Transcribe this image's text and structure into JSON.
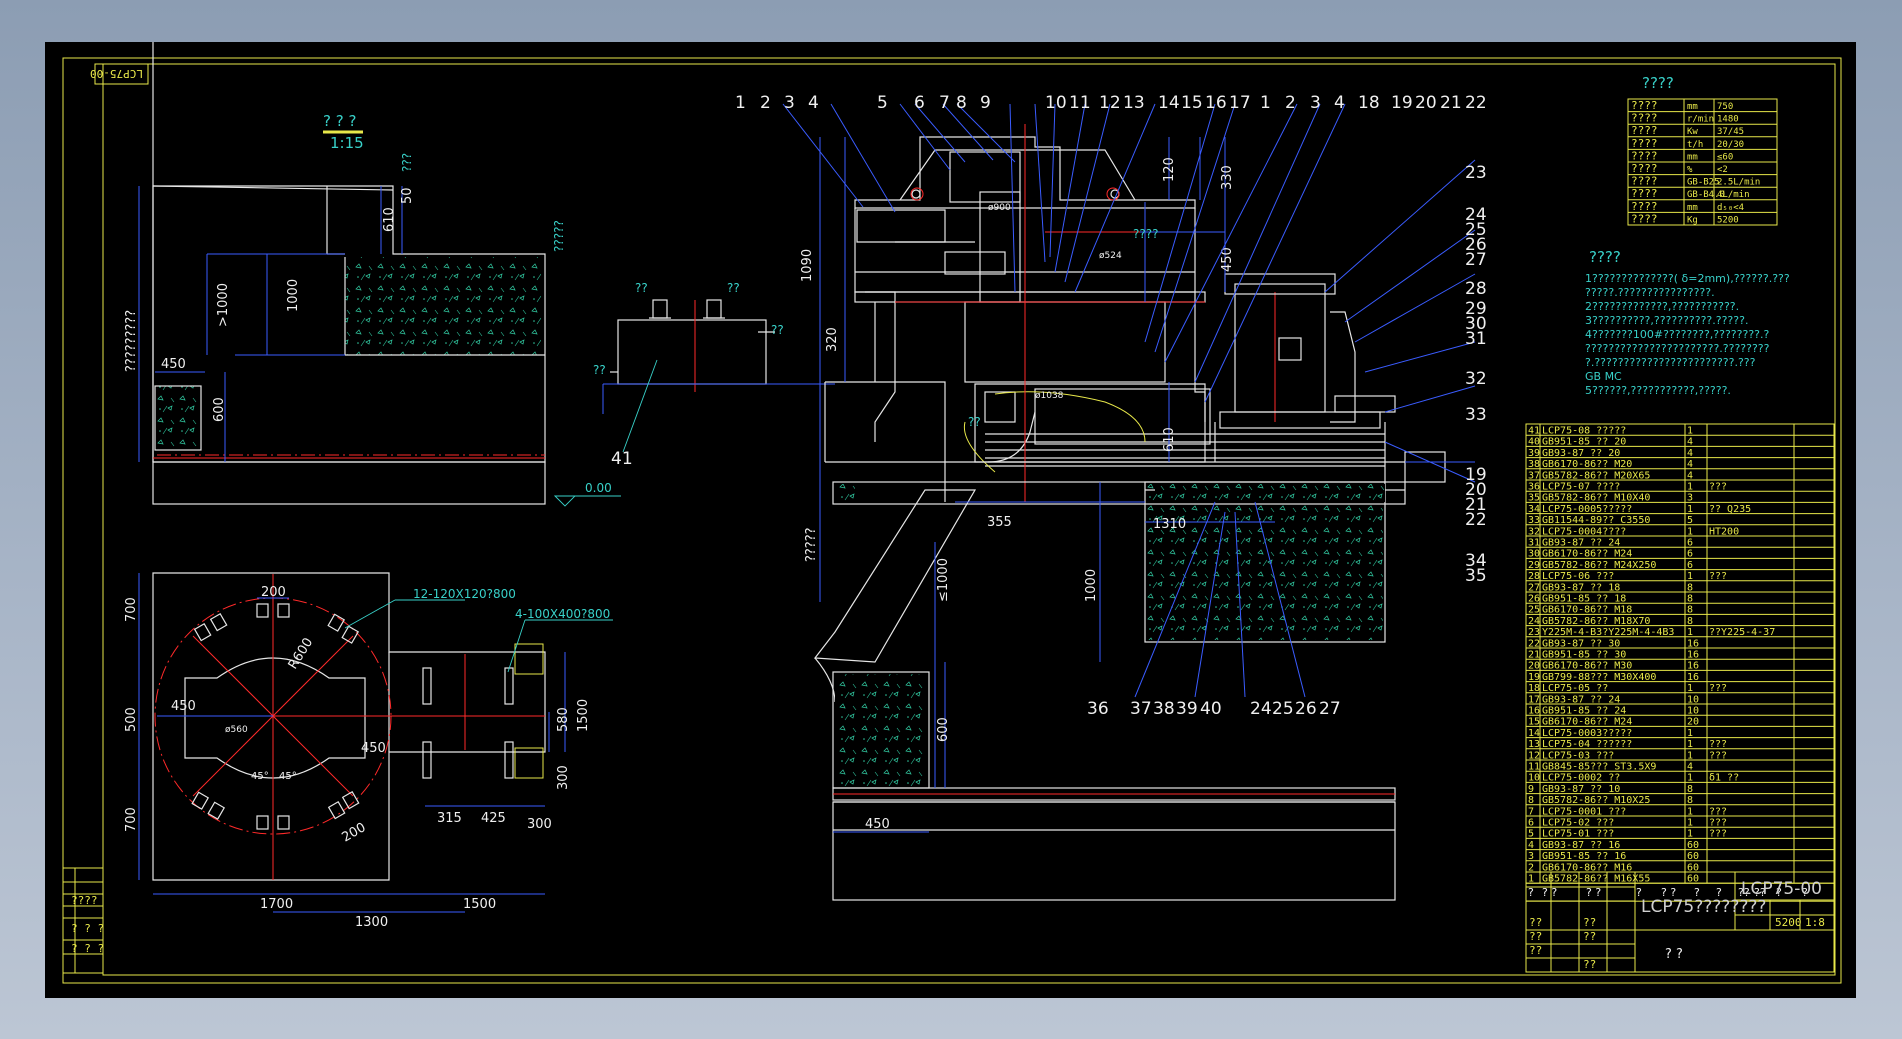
{
  "sheet_label": "LCP75-00",
  "view_title": "? ? ?",
  "view_scale": "1:15",
  "balloons_top": [
    "1",
    "2",
    "3",
    "4",
    "5",
    "6",
    "7",
    "8",
    "9",
    "10",
    "11",
    "12",
    "13",
    "14",
    "15",
    "16",
    "17",
    "1",
    "2",
    "3",
    "4",
    "18",
    "19",
    "20",
    "21",
    "22"
  ],
  "balloons_right": [
    "23",
    "24",
    "25",
    "26",
    "27",
    "28",
    "29",
    "30",
    "31",
    "32",
    "33",
    "19",
    "20",
    "21",
    "22",
    "34",
    "35"
  ],
  "balloons_bottom": [
    "36",
    "37",
    "38",
    "39",
    "40",
    "24",
    "25",
    "26",
    "27"
  ],
  "balloon_41": "41",
  "elevation_dims": {
    "d450": "450",
    "d600": "600",
    "d1000": "1000",
    "d1000b": ">1000",
    "d610": "610",
    "d50": "50",
    "dq": "?????????",
    "dtop": "???",
    "dright": "?????"
  },
  "level_mark": "0.00",
  "plan_dims": [
    "200",
    "700",
    "500",
    "700",
    "450",
    "R600",
    "ø560",
    "450",
    "1700",
    "1300",
    "1500",
    "580",
    "1500",
    "300",
    "315",
    "425",
    "300",
    "200",
    "45°",
    "45°"
  ],
  "plan_callouts": [
    "12-120X120?800",
    "4-100X400?800"
  ],
  "tank_labels": [
    "??",
    "??",
    "??",
    "??"
  ],
  "main_dims": {
    "d1090": "1090",
    "d320": "320",
    "d120": "120",
    "d330": "330",
    "d450": "450",
    "d610": "610",
    "d355": "355",
    "d1310": "1310",
    "d1000": "1000",
    "d1000b": "≤1000",
    "d600": "600",
    "d450b": "450",
    "dq": "?????",
    "ø900": "ø900",
    "ø524": "ø524",
    "ø1038": "ø1038",
    "q1": "????",
    "q2": "??"
  },
  "spec_title": "????",
  "spec_rows": [
    [
      "????",
      "mm",
      "750"
    ],
    [
      "????",
      "r/min",
      "1480"
    ],
    [
      "????",
      "Kw",
      "37/45"
    ],
    [
      "????",
      "t/h",
      "20/30"
    ],
    [
      "????",
      "mm",
      "≤60"
    ],
    [
      "????",
      "%",
      "<2"
    ],
    [
      "????",
      "GB-B25",
      "2.5L/min"
    ],
    [
      "????",
      "GB-B4.0",
      "4L/min"
    ],
    [
      "????",
      "mm",
      "d₅₀<4"
    ],
    [
      "????",
      "Kg",
      "5200"
    ]
  ],
  "notes_title": "????",
  "notes": [
    "1??????????????( δ=2mm),??????.???",
    "  ?????.????????????????.",
    "2?????????????,???????????.",
    "3??????????,??????????.?????.",
    "4???????100#????????,????????.?",
    "  ???????????????????????.????????",
    "  ?.????????????????????????.???",
    "  GB MC",
    "5??????,???????????,?????."
  ],
  "bom": [
    [
      "41",
      "LCP75-08 ?????",
      "1",
      ""
    ],
    [
      "40",
      "GB951-85 ??  20",
      "4",
      ""
    ],
    [
      "39",
      "GB93-87 ??  20",
      "4",
      ""
    ],
    [
      "38",
      "GB6170-86?? M20",
      "4",
      ""
    ],
    [
      "37",
      "GB5782-86?? M20X65",
      "4",
      ""
    ],
    [
      "36",
      "LCP75-07 ????",
      "1",
      "???"
    ],
    [
      "35",
      "GB5782-86?? M10X40",
      "3",
      ""
    ],
    [
      "34",
      "LCP75-0005?????",
      "1",
      "?? Q235"
    ],
    [
      "33",
      "GB11544-89?? C3550",
      "5",
      ""
    ],
    [
      "32",
      "LCP75-0004????",
      "1",
      "HT200"
    ],
    [
      "31",
      "GB93-87 ??  24",
      "6",
      ""
    ],
    [
      "30",
      "GB6170-86?? M24",
      "6",
      ""
    ],
    [
      "29",
      "GB5782-86?? M24X250",
      "6",
      ""
    ],
    [
      "28",
      "LCP75-06 ???",
      "1",
      "???"
    ],
    [
      "27",
      "GB93-87 ??  18",
      "8",
      ""
    ],
    [
      "26",
      "GB951-85 ??  18",
      "8",
      ""
    ],
    [
      "25",
      "GB6170-86?? M18",
      "8",
      ""
    ],
    [
      "24",
      "GB5782-86?? M18X70",
      "8",
      ""
    ],
    [
      "23",
      "Y225M-4-B3?Y225M-4-4B3",
      "1",
      "??Y225-4-37"
    ],
    [
      "22",
      "GB93-87 ??  30",
      "16",
      ""
    ],
    [
      "21",
      "GB951-85 ??  30",
      "16",
      ""
    ],
    [
      "20",
      "GB6170-86?? M30",
      "16",
      ""
    ],
    [
      "19",
      "GB799-88??? M30X400",
      "16",
      ""
    ],
    [
      "18",
      "LCP75-05 ??",
      "1",
      "???"
    ],
    [
      "17",
      "GB93-87 ??  24",
      "10",
      ""
    ],
    [
      "16",
      "GB951-85 ??  24",
      "10",
      ""
    ],
    [
      "15",
      "GB6170-86?? M24",
      "20",
      ""
    ],
    [
      "14",
      "LCP75-0003?????",
      "1",
      ""
    ],
    [
      "13",
      "LCP75-04 ??????",
      "1",
      "???"
    ],
    [
      "12",
      "LCP75-03 ???",
      "1",
      "???"
    ],
    [
      "11",
      "GB845-85??? ST3.5X9",
      "4",
      ""
    ],
    [
      "10",
      "LCP75-0002 ??",
      "1",
      "δ1 ??"
    ],
    [
      "9",
      "GB93-87 ??  10",
      "8",
      ""
    ],
    [
      "8",
      "GB5782-86?? M10X25",
      "8",
      ""
    ],
    [
      "7",
      "LCP75-0001 ???",
      "1",
      "???"
    ],
    [
      "6",
      "LCP75-02 ???",
      "1",
      "???"
    ],
    [
      "5",
      "LCP75-01 ???",
      "1",
      "???"
    ],
    [
      "4",
      "GB93-87 ??  16",
      "60",
      ""
    ],
    [
      "3",
      "GB951-85 ??  16",
      "60",
      ""
    ],
    [
      "2",
      "GB6170-86?? M16",
      "60",
      ""
    ],
    [
      "1",
      "GB5782-86?? M16X55",
      "60",
      ""
    ]
  ],
  "bom_header": [
    "?",
    "?  ?",
    "?  ?",
    "?",
    "?  ?",
    "?",
    "?",
    "??",
    "??",
    "?",
    "?"
  ],
  "title_block": {
    "name": "LCP75????????",
    "drawing_no": "LCP75-00",
    "mass": "5200",
    "scale": "1:8",
    "unit": "?  ?",
    "marks": [
      "??",
      "??",
      "??",
      "??",
      "??",
      "??"
    ]
  },
  "left_strip": [
    "????",
    "? ? ?",
    "? ? ?"
  ],
  "colors": {
    "background": "#000000",
    "frame": "#e8e84a",
    "outline": "#e6e6e6",
    "dimension": "#3a5cff",
    "centerline": "#ff2a2a",
    "annotation": "#38d0c8"
  }
}
